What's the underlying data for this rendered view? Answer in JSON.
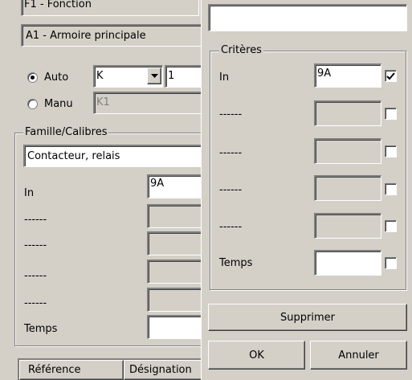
{
  "left": {
    "fonction_value": "F1 - Fonction",
    "armoire_value": "A1 - Armoire principale",
    "auto_label": "Auto",
    "manu_label": "Manu",
    "auto_select": "K",
    "auto_number": "1",
    "manu_value": "K1",
    "famille": {
      "title": "Famille/Calibres",
      "type_value": "Contacteur, relais",
      "in_label": "In",
      "in_value": "9A",
      "dash1": "------",
      "dash2": "------",
      "dash3": "------",
      "dash4": "------",
      "temps_label": "Temps"
    },
    "table_headers": [
      "Référence",
      "Désignation"
    ]
  },
  "right": {
    "criteres": {
      "title": "Critères",
      "in_label": "In",
      "in_value": "9A",
      "in_checked": true,
      "dash1": "------",
      "dash2": "------",
      "dash3": "------",
      "dash4": "------",
      "temps_label": "Temps"
    },
    "supprimer_label": "Supprimer",
    "ok_label": "OK",
    "annuler_label": "Annuler"
  }
}
